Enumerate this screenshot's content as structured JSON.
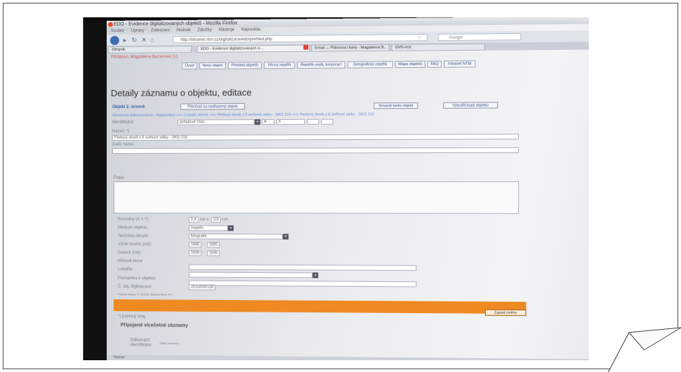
{
  "browser": {
    "window_title": "EDO - Evidence digitalizovaných objektů - Mozilla Firefox",
    "menu": [
      "Soubor",
      "Úpravy",
      "Zobrazení",
      "Historie",
      "Záložky",
      "Nástroje",
      "Nápověda"
    ],
    "url": "http://intranet.ntm.cz/digitalizace/edo/prehled.php",
    "search_placeholder": "Google",
    "tabs": [
      "Zdrojník",
      "EDO - Evidence digitalizovaných o...",
      "Email — Plánovací karty - Magdalena B...",
      "EMS-test"
    ],
    "status": "Hotovo"
  },
  "page": {
    "user_line": "Přihlášen: Magdalena Bucanová (U)",
    "nav_buttons": [
      "Úvod",
      "Nový objekt",
      "Přehled objektů",
      "Věcný rejstřík",
      "Rejstřík osob, korporací",
      "Geografický rejstřík",
      "Mapa objektů",
      "FAQ",
      "Intranet NTM"
    ],
    "heading": "Detaily záznamu o objektu, editace",
    "object_level": "Objekt 2. úrovně",
    "btn_parent": "Přechod na nadřazený objekt",
    "btn_delete": "Smazat tento objekt",
    "btn_copy": "Vytvořit kopii objektu",
    "breadcrumb": "Obrazová dokumentace - digitalizace >>> Letadlo sbírek >>> Pletlový deník z 6 světové války - SKG 210 >>> Pletlový deník z 6 světové války - SKG 210",
    "fields": {
      "identifikator_label": "Identifikátor",
      "identifikator_value": "pořadové číslo",
      "identifikator_a": "A",
      "identifikator_b": "5",
      "nazev_label": "Název: *)",
      "nazev_value": "Pletlový deník z 6 světové války - SKG 210",
      "dalsi_nazev_label": "Další název",
      "popis_label": "Popis",
      "rozmery_label": "Rozměry (X × Y)",
      "rozmer_x": "2,4",
      "rozmer_x_unit": "cm x",
      "rozmer_y": "3,6",
      "rozmer_y_unit": "cm",
      "medium_label": "Médium objektu",
      "medium_value": "negativ",
      "technika_label": "Technika obrazu",
      "technika_value": "fotografie",
      "vznik_label": "Vznik nosiče (rok)",
      "vznik_from": "1865",
      "vznik_to": "1865",
      "datace_label": "Datace (rok)",
      "datace_from": "1939",
      "datace_to": "1945",
      "klicova_label": "Klíčová slova",
      "lokalita_label": "Lokalita",
      "poznamka_label": "Poznámka k objektu",
      "datum_label": "Č. obj. digitalizace",
      "datum_value": "2010/00012E"
    },
    "edit_hint": "Poslední editace: 17.08.2010 Tarbiková Anna, 34.1...",
    "save_button": "Zapsat změny",
    "required_note": "*) povinný údaj",
    "linked_heading": "Připojené vícečetné záznamy",
    "linked_label": "Odkazující identifikátor",
    "linked_value": "Žádný záznamy"
  },
  "colors": {
    "accent_orange": "#ef8a22",
    "link_blue": "#3a5f9f",
    "user_pink": "#c56"
  }
}
